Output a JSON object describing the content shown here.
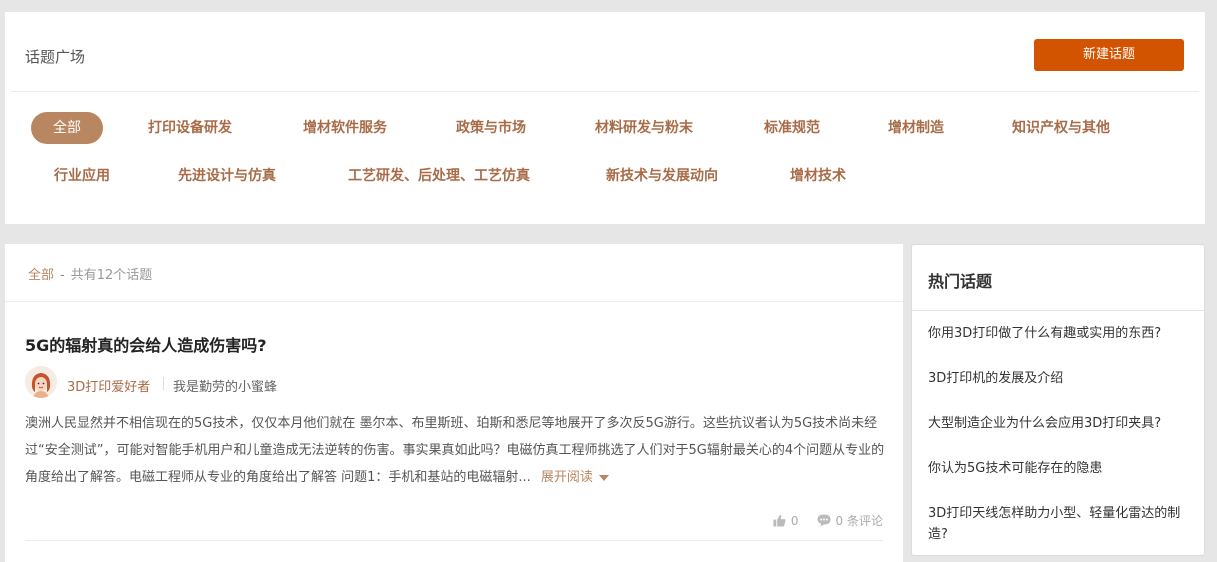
{
  "header": {
    "title": "话题广场",
    "new_topic_label": "新建话题"
  },
  "categories": {
    "row1": [
      "全部",
      "打印设备研发",
      "增材软件服务",
      "政策与市场",
      "材料研发与粉末",
      "标准规范",
      "增材制造",
      "知识产权与其他"
    ],
    "row2": [
      "行业应用",
      "先进设计与仿真",
      "工艺研发、后处理、工艺仿真",
      "新技术与发展动向",
      "增材技术"
    ],
    "active": "全部"
  },
  "list": {
    "breadcrumb_current": "全部",
    "breadcrumb_sep": "-",
    "count_text": "共有12个话题"
  },
  "topic": {
    "title": "5G的辐射真的会给人造成伤害吗?",
    "author": "3D打印爱好者",
    "signature": "我是勤劳的小蜜蜂",
    "excerpt": "澳洲人民显然并不相信现在的5G技术，仅仅本月他们就在 墨尔本、布里斯班、珀斯和悉尼等地展开了多次反5G游行。这些抗议者认为5G技术尚未经过“安全测试”，可能对智能手机用户和儿童造成无法逆转的伤害。事实果真如此吗？电磁仿真工程师挑选了人们对于5G辐射最关心的4个问题从专业的角度给出了解答。电磁工程师从专业的角度给出了解答 问题1：手机和基站的电磁辐射...",
    "expand_label": "展开阅读",
    "likes": "0",
    "comments": "0 条评论"
  },
  "hot": {
    "title": "热门话题",
    "items": [
      "你用3D打印做了什么有趣或实用的东西?",
      "3D打印机的发展及介绍",
      "大型制造企业为什么会应用3D打印夹具?",
      "你认为5G技术可能存在的隐患",
      "3D打印天线怎样助力小型、轻量化雷达的制造?"
    ]
  },
  "colors": {
    "accent": "#d35400",
    "brand_brown": "#b88660",
    "link_brown": "#a86c48"
  },
  "icons": {
    "like": "thumb-up-icon",
    "comment": "comment-bubble-icon",
    "expand": "caret-down-icon"
  }
}
